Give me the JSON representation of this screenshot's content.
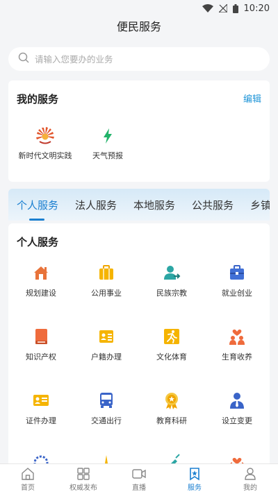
{
  "status_bar": {
    "time": "10:20",
    "icons": [
      "wifi-icon",
      "no-signal-icon",
      "battery-icon"
    ]
  },
  "header": {
    "title": "便民服务"
  },
  "search": {
    "placeholder": "请输入您要办的业务",
    "icon": "search-icon"
  },
  "my_services": {
    "title": "我的服务",
    "edit_label": "编辑",
    "items": [
      {
        "label": "新时代文明实践",
        "icon": "civilization-logo-icon"
      },
      {
        "label": "天气预报",
        "icon": "lightning-icon"
      }
    ]
  },
  "tabs": [
    {
      "label": "个人服务",
      "active": true
    },
    {
      "label": "法人服务"
    },
    {
      "label": "本地服务"
    },
    {
      "label": "公共服务"
    },
    {
      "label": "乡镇服务"
    }
  ],
  "personal_services": {
    "title": "个人服务",
    "items": [
      {
        "label": "规划建设",
        "icon": "house-icon"
      },
      {
        "label": "公用事业",
        "icon": "briefcase-icon"
      },
      {
        "label": "民族宗教",
        "icon": "person-arrow-icon"
      },
      {
        "label": "就业创业",
        "icon": "toolbox-icon"
      },
      {
        "label": "知识产权",
        "icon": "book-icon"
      },
      {
        "label": "户籍办理",
        "icon": "id-card-icon"
      },
      {
        "label": "文化体育",
        "icon": "runner-icon"
      },
      {
        "label": "生育收养",
        "icon": "family-icon"
      },
      {
        "label": "证件办理",
        "icon": "certificate-icon"
      },
      {
        "label": "交通出行",
        "icon": "bus-icon"
      },
      {
        "label": "教育科研",
        "icon": "medal-icon"
      },
      {
        "label": "设立变更",
        "icon": "user-tie-icon"
      }
    ]
  },
  "bottom_nav": [
    {
      "label": "首页",
      "icon": "home-icon"
    },
    {
      "label": "权威发布",
      "icon": "grid-icon"
    },
    {
      "label": "直播",
      "icon": "video-icon"
    },
    {
      "label": "服务",
      "icon": "bookmark-star-icon",
      "active": true
    },
    {
      "label": "我的",
      "icon": "profile-icon"
    }
  ],
  "colors": {
    "accent": "#1a7fd0",
    "edit": "#2196d8",
    "background": "#f4f5f7"
  }
}
